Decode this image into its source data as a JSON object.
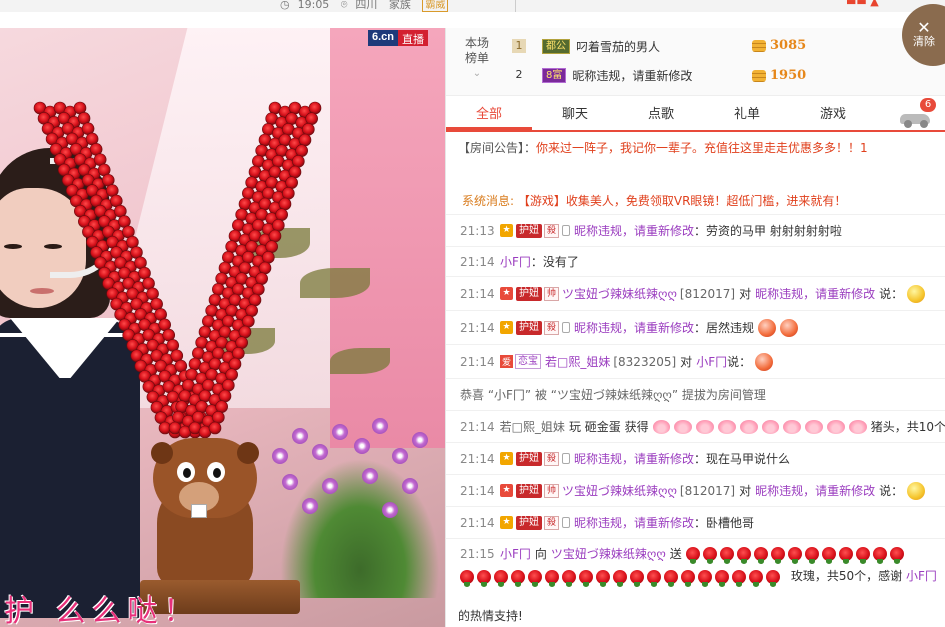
{
  "top_bar": {
    "time": "19:05",
    "region": "四川",
    "tag": "家族",
    "badge": "霸威"
  },
  "video": {
    "logo": "6.cn",
    "live_label": "直播",
    "caption": "护 么么哒！"
  },
  "ranking": {
    "title_line1": "本场",
    "title_line2": "榜单",
    "rows": [
      {
        "rank": "1",
        "level_badge": "都公",
        "name": "叼着雪茄的男人",
        "score": "3085"
      },
      {
        "rank": "2",
        "level_badge": "8富",
        "name": "昵称违规，请重新修改",
        "score": "1950"
      }
    ]
  },
  "clear_button": {
    "label": "清除"
  },
  "tabs": [
    {
      "label": "全部"
    },
    {
      "label": "聊天"
    },
    {
      "label": "点歌"
    },
    {
      "label": "礼单"
    },
    {
      "label": "游戏"
    }
  ],
  "car_badge": "6",
  "notice": {
    "label": "【房间公告】：",
    "text": "你来过一阵子，我记你一辈子。充值往这里走走优惠多多！！1"
  },
  "system": {
    "label": "系统消息:",
    "text": "【游戏】收集美人，免费领取VR眼镜！超低门槛，进来就有！"
  },
  "messages": {
    "m1": {
      "time": "21:13",
      "hn": "护妞",
      "lvl": "殺",
      "user": "昵称违规，请重新修改",
      "text": "：劳资的马甲 射射射射射啦"
    },
    "m2": {
      "time": "21:14",
      "user": "小F冂",
      "text": "：没有了"
    },
    "m3": {
      "time": "21:14",
      "hn": "护妞",
      "lvl": "帅",
      "user": "ツ宝妞づ辣妹纸辣ღღ",
      "id": "[812017]",
      "to": "对",
      "target": "昵称违规，请重新修改",
      "say": "说："
    },
    "m4": {
      "time": "21:14",
      "hn": "护妞",
      "lvl": "殺",
      "user": "昵称违规，请重新修改",
      "text": "：居然违规"
    },
    "m5": {
      "time": "21:14",
      "tag": "爱",
      "tag2": "恋宝",
      "user": "若□熙_姐妹",
      "id": "[8323205]",
      "to": "对",
      "target": "小F冂",
      "say": "说："
    },
    "m6": {
      "text": "恭喜 “小F冂” 被 “ツ宝妞づ辣妹纸辣ღღ” 提拔为房间管理"
    },
    "m7": {
      "time": "21:14",
      "user": "若□熙_姐妹",
      "action": "玩 砸金蛋 获得",
      "suffix": "猪头，共10个"
    },
    "m8": {
      "time": "21:14",
      "hn": "护妞",
      "lvl": "殺",
      "user": "昵称违规，请重新修改",
      "text": "：现在马甲说什么"
    },
    "m9": {
      "time": "21:14",
      "hn": "护妞",
      "lvl": "帅",
      "user": "ツ宝妞づ辣妹纸辣ღღ",
      "id": "[812017]",
      "to": "对",
      "target": "昵称违规，请重新修改",
      "say": "说："
    },
    "m10": {
      "time": "21:14",
      "hn": "护妞",
      "lvl": "殺",
      "user": "昵称违规，请重新修改",
      "text": "：卧槽他哥"
    },
    "m11": {
      "time": "21:15",
      "user": "小F冂",
      "to": "向",
      "target": "ツ宝妞づ辣妹纸辣ღღ",
      "send": "送",
      "gift_text": "玫瑰，共50个，感谢",
      "thanks_user": "小F冂",
      "thanks_suffix": "的热情支持!"
    }
  },
  "colors": {
    "accent": "#e84a3a",
    "username": "#9a3cbf",
    "system": "#d97c1e"
  }
}
